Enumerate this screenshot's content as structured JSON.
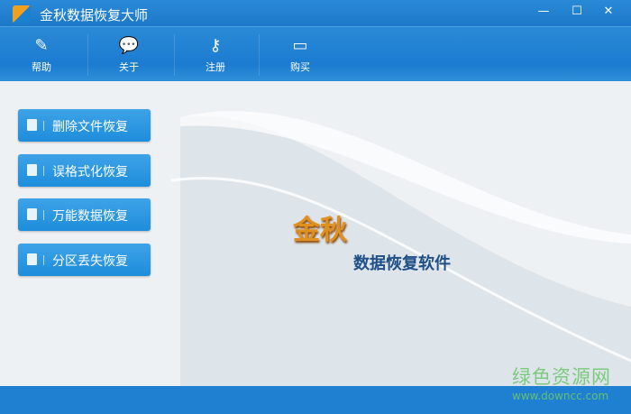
{
  "window": {
    "title": "金秋数据恢复大师",
    "minimize": "—",
    "maximize": "☐",
    "close": "✕"
  },
  "toolbar": [
    {
      "label": "帮助",
      "icon": "brush-icon",
      "glyph": "✎"
    },
    {
      "label": "关于",
      "icon": "chat-bubbles-icon",
      "glyph": "💬"
    },
    {
      "label": "注册",
      "icon": "key-icon",
      "glyph": "⚷"
    },
    {
      "label": "购买",
      "icon": "credit-card-icon",
      "glyph": "▭"
    }
  ],
  "nav": [
    {
      "label": "删除文件恢复",
      "icon": "trash-icon"
    },
    {
      "label": "误格式化恢复",
      "icon": "format-icon"
    },
    {
      "label": "万能数据恢复",
      "icon": "file-gear-icon"
    },
    {
      "label": "分区丢失恢复",
      "icon": "partition-icon"
    }
  ],
  "brand": {
    "name": "金秋",
    "subtitle": "数据恢复软件"
  },
  "watermark": {
    "name": "绿色资源网",
    "url": "www.downcc.com"
  }
}
